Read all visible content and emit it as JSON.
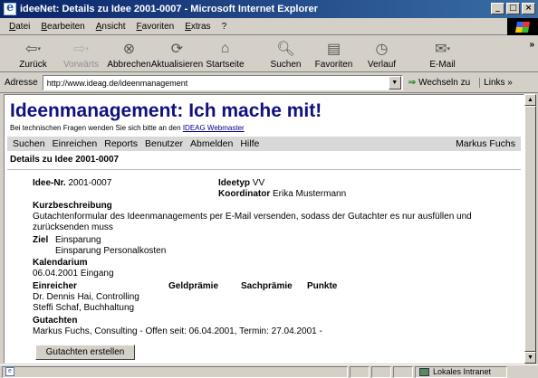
{
  "window": {
    "title": "ideeNet: Details zu Idee 2001-0007 - Microsoft Internet Explorer",
    "minimize": "_",
    "maximize": "□",
    "close": "×"
  },
  "menu": [
    "Datei",
    "Bearbeiten",
    "Ansicht",
    "Favoriten",
    "Extras",
    "?"
  ],
  "toolbar": {
    "back": "Zurück",
    "forward": "Vorwärts",
    "stop": "Abbrechen",
    "refresh": "Aktualisieren",
    "home": "Startseite",
    "search": "Suchen",
    "favorites": "Favoriten",
    "history": "Verlauf",
    "mail": "E-Mail"
  },
  "address": {
    "label": "Adresse",
    "url": "http://www.ideag.de/ideenmanagement",
    "go": "Wechseln zu",
    "links": "Links"
  },
  "page": {
    "title": "Ideenmanagement: Ich mache mit!",
    "help_text": "Bei technischen Fragen wenden Sie sich bitte an den",
    "help_link": "IDEAG Webmaster",
    "nav": [
      "Suchen",
      "Einreichen",
      "Reports",
      "Benutzer",
      "Abmelden",
      "Hilfe"
    ],
    "user": "Markus Fuchs",
    "subheading": "Details zu Idee 2001-0007",
    "idea_nr_label": "Idee-Nr.",
    "idea_nr": "2001-0007",
    "idea_type_label": "Ideetyp",
    "idea_type": "VV",
    "coordinator_label": "Koordinator",
    "coordinator": "Erika Mustermann",
    "summary_label": "Kurzbeschreibung",
    "summary_line1": "Gutachtenformular des Ideenmanagements per E-Mail versenden, sodass der Gutachter es nur ausfüllen und",
    "summary_line2": "zurücksenden muss",
    "goal_label": "Ziel",
    "goals": [
      "Einsparung",
      "Einsparung Personalkosten"
    ],
    "calendar_label": "Kalendarium",
    "calendar_entry": "06.04.2001 Eingang",
    "submitter_label": "Einreicher",
    "cash_bonus_label": "Geldprämie",
    "prize_label": "Sachprämie",
    "points_label": "Punkte",
    "submitters": [
      "Dr. Dennis Hai, Controlling",
      "Steffi Schaf, Buchhaltung"
    ],
    "reviews_label": "Gutachten",
    "review_entry": "Markus Fuchs, Consulting  - Offen seit: 06.04.2001, Termin: 27.04.2001 -",
    "create_review_button": "Gutachten erstellen"
  },
  "status": {
    "zone": "Lokales Intranet"
  }
}
